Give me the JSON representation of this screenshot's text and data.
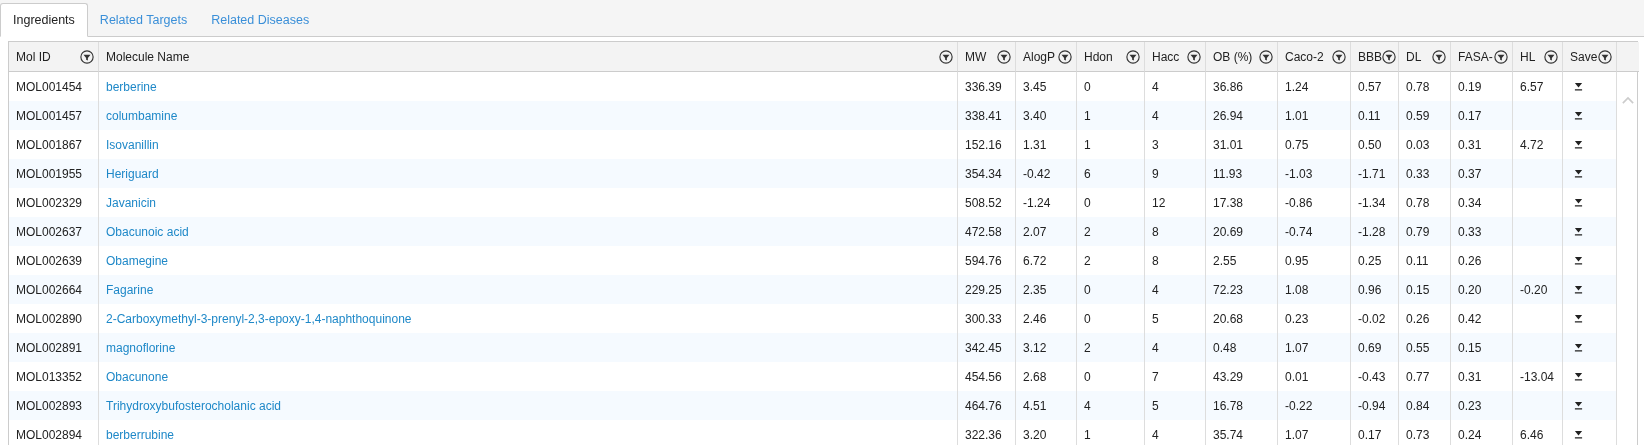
{
  "tabs": [
    {
      "label": "Ingredients",
      "selected": true
    },
    {
      "label": "Related Targets",
      "selected": false
    },
    {
      "label": "Related Diseases",
      "selected": false
    }
  ],
  "table": {
    "columns": [
      "Mol ID",
      "Molecule Name",
      "MW",
      "AlogP",
      "Hdon",
      "Hacc",
      "OB (%)",
      "Caco-2",
      "BBB",
      "DL",
      "FASA-",
      "HL",
      "Save"
    ],
    "rows": [
      {
        "mol_id": "MOL001454",
        "molecule_name": "berberine",
        "mw": "336.39",
        "alogp": "3.45",
        "hdon": "0",
        "hacc": "4",
        "ob": "36.86",
        "caco_2": "1.24",
        "bbb": "0.57",
        "dl": "0.78",
        "fasa": "0.19",
        "hl": "6.57"
      },
      {
        "mol_id": "MOL001457",
        "molecule_name": "columbamine",
        "mw": "338.41",
        "alogp": "3.40",
        "hdon": "1",
        "hacc": "4",
        "ob": "26.94",
        "caco_2": "1.01",
        "bbb": "0.11",
        "dl": "0.59",
        "fasa": "0.17"
      },
      {
        "mol_id": "MOL001867",
        "molecule_name": "Isovanillin",
        "mw": "152.16",
        "alogp": "1.31",
        "hdon": "1",
        "hacc": "3",
        "ob": "31.01",
        "caco_2": "0.75",
        "bbb": "0.50",
        "dl": "0.03",
        "fasa": "0.31",
        "hl": "4.72"
      },
      {
        "mol_id": "MOL001955",
        "molecule_name": "Heriguard",
        "mw": "354.34",
        "alogp": "-0.42",
        "hdon": "6",
        "hacc": "9",
        "ob": "11.93",
        "caco_2": "-1.03",
        "bbb": "-1.71",
        "dl": "0.33",
        "fasa": "0.37"
      },
      {
        "mol_id": "MOL002329",
        "molecule_name": "Javanicin",
        "mw": "508.52",
        "alogp": "-1.24",
        "hdon": "0",
        "hacc": "12",
        "ob": "17.38",
        "caco_2": "-0.86",
        "bbb": "-1.34",
        "dl": "0.78",
        "fasa": "0.34"
      },
      {
        "mol_id": "MOL002637",
        "molecule_name": "Obacunoic acid",
        "mw": "472.58",
        "alogp": "2.07",
        "hdon": "2",
        "hacc": "8",
        "ob": "20.69",
        "caco_2": "-0.74",
        "bbb": "-1.28",
        "dl": "0.79",
        "fasa": "0.33"
      },
      {
        "mol_id": "MOL002639",
        "molecule_name": "Obamegine",
        "mw": "594.76",
        "alogp": "6.72",
        "hdon": "2",
        "hacc": "8",
        "ob": "2.55",
        "caco_2": "0.95",
        "bbb": "0.25",
        "dl": "0.11",
        "fasa": "0.26"
      },
      {
        "mol_id": "MOL002664",
        "molecule_name": "Fagarine",
        "mw": "229.25",
        "alogp": "2.35",
        "hdon": "0",
        "hacc": "4",
        "ob": "72.23",
        "caco_2": "1.08",
        "bbb": "0.96",
        "dl": "0.15",
        "fasa": "0.20",
        "hl": "-0.20"
      },
      {
        "mol_id": "MOL002890",
        "molecule_name": "2-Carboxymethyl-3-prenyl-2,3-epoxy-1,4-naphthoquinone",
        "mw": "300.33",
        "alogp": "2.46",
        "hdon": "0",
        "hacc": "5",
        "ob": "20.68",
        "caco_2": "0.23",
        "bbb": "-0.02",
        "dl": "0.26",
        "fasa": "0.42"
      },
      {
        "mol_id": "MOL002891",
        "molecule_name": "magnoflorine",
        "mw": "342.45",
        "alogp": "3.12",
        "hdon": "2",
        "hacc": "4",
        "ob": "0.48",
        "caco_2": "1.07",
        "bbb": "0.69",
        "dl": "0.55",
        "fasa": "0.15"
      },
      {
        "mol_id": "MOL013352",
        "molecule_name": "Obacunone",
        "mw": "454.56",
        "alogp": "2.68",
        "hdon": "0",
        "hacc": "7",
        "ob": "43.29",
        "caco_2": "0.01",
        "bbb": "-0.43",
        "dl": "0.77",
        "fasa": "0.31",
        "hl": "-13.04"
      },
      {
        "mol_id": "MOL002893",
        "molecule_name": "Trihydroxybufosterocholanic acid",
        "mw": "464.76",
        "alogp": "4.51",
        "hdon": "4",
        "hacc": "5",
        "ob": "16.78",
        "caco_2": "-0.22",
        "bbb": "-0.94",
        "dl": "0.84",
        "fasa": "0.23"
      },
      {
        "mol_id": "MOL002894",
        "molecule_name": "berberrubine",
        "mw": "322.36",
        "alogp": "3.20",
        "hdon": "1",
        "hacc": "4",
        "ob": "35.74",
        "caco_2": "1.07",
        "bbb": "0.17",
        "dl": "0.73",
        "fasa": "0.24",
        "hl": "6.46"
      }
    ]
  }
}
